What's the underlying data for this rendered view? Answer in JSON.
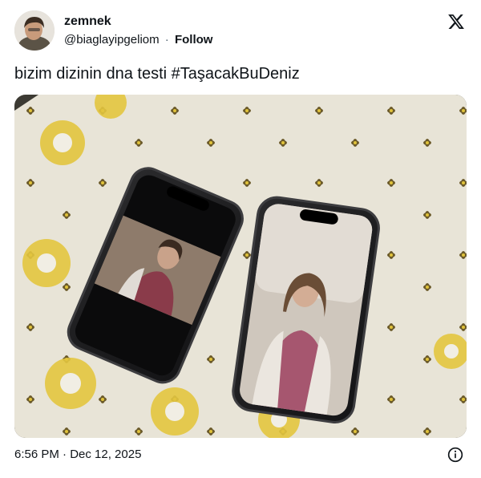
{
  "tweet": {
    "author_name": "zemnek",
    "handle": "@biaglayipgeliom",
    "separator": "·",
    "follow_label": "Follow",
    "text": "bizim dizinin dna testi #TaşacakBuDeniz",
    "timestamp": "6:56 PM · Dec 12, 2025"
  },
  "icons": {
    "platform_logo": "x-logo-icon",
    "info": "info-icon"
  },
  "media": {
    "description_colors": {
      "cloth": "#e9e5d8",
      "embroidery": "#e0c23a",
      "phone_frame": "#1c1c1e"
    }
  }
}
